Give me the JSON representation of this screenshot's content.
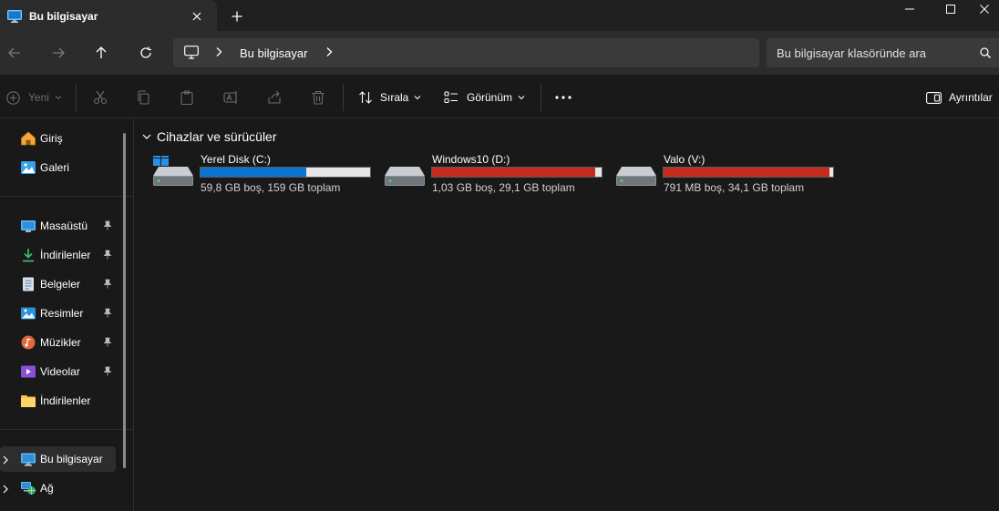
{
  "window": {
    "tab_title": "Bu bilgisayar",
    "tab_icon": "monitor-icon"
  },
  "address": {
    "location": "Bu bilgisayar",
    "search_placeholder": "Bu bilgisayar klasöründe ara"
  },
  "commands": {
    "new_label": "Yeni",
    "sort_label": "Sırala",
    "view_label": "Görünüm",
    "details_label": "Ayrıntılar"
  },
  "sidebar": {
    "items": [
      {
        "label": "Giriş",
        "icon": "home-icon"
      },
      {
        "label": "Galeri",
        "icon": "gallery-icon"
      },
      {
        "label": "Masaüstü",
        "icon": "desktop-icon",
        "pinned": true
      },
      {
        "label": "İndirilenler",
        "icon": "download-icon",
        "pinned": true
      },
      {
        "label": "Belgeler",
        "icon": "documents-icon",
        "pinned": true
      },
      {
        "label": "Resimler",
        "icon": "pictures-icon",
        "pinned": true
      },
      {
        "label": "Müzikler",
        "icon": "music-icon",
        "pinned": true
      },
      {
        "label": "Videolar",
        "icon": "videos-icon",
        "pinned": true
      },
      {
        "label": "İndirilenler",
        "icon": "folder-icon",
        "pinned": false
      },
      {
        "label": "Bu bilgisayar",
        "icon": "monitor-icon",
        "selected": true
      },
      {
        "label": "Ağ",
        "icon": "network-icon"
      }
    ]
  },
  "main": {
    "group_title": "Cihazlar ve sürücüler",
    "drives": [
      {
        "name": "Yerel Disk (C:)",
        "size_text": "59,8 GB boş, 159 GB toplam",
        "used_fraction": 0.624,
        "bar_color": "#0c73d1"
      },
      {
        "name": "Windows10 (D:)",
        "size_text": "1,03 GB boş, 29,1 GB toplam",
        "used_fraction": 0.965,
        "bar_color": "#c42b1c"
      },
      {
        "name": "Valo (V:)",
        "size_text": "791 MB boş, 34,1 GB toplam",
        "used_fraction": 0.977,
        "bar_color": "#c42b1c"
      }
    ]
  },
  "colors": {
    "accent": "#0c73d1",
    "warning_bar": "#c42b1c",
    "background": "#191919"
  }
}
